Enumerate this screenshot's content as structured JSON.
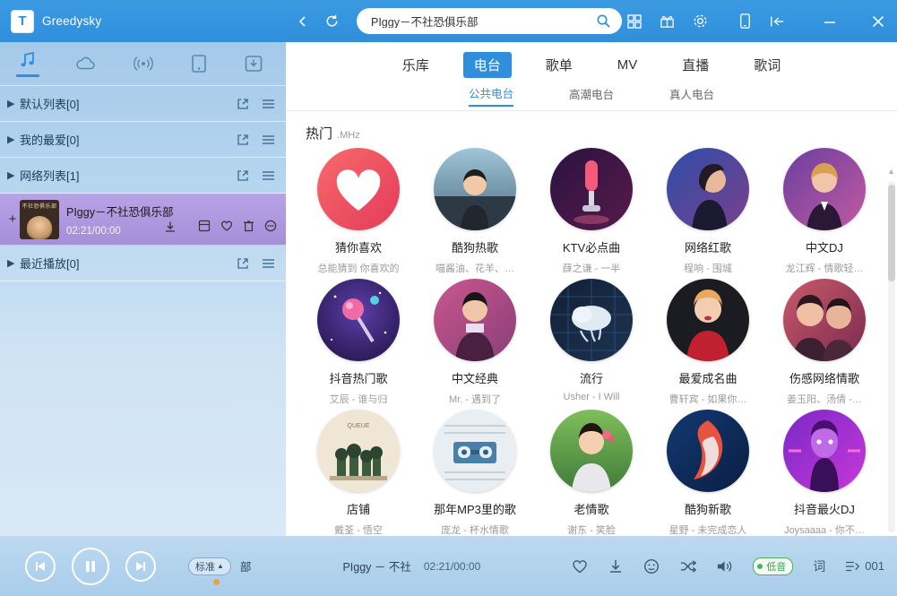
{
  "titlebar": {
    "app_name": "Greedysky",
    "logo_letter": "T",
    "search_value": "PIggy－不社恐俱乐部",
    "icons": {
      "back": "back-arrow-icon",
      "refresh": "refresh-icon",
      "search": "search-icon",
      "radar": "radar-icon",
      "grid": "grid-icon",
      "gift": "gift-icon",
      "settings": "gear-icon",
      "mobile": "mobile-icon",
      "collapse": "collapse-icon",
      "minimize": "minimize-icon",
      "close": "close-icon"
    }
  },
  "sidebar": {
    "tabs": [
      {
        "name": "music",
        "icon": "music-note-icon",
        "active": true
      },
      {
        "name": "cloud",
        "icon": "cloud-icon",
        "active": false
      },
      {
        "name": "radio",
        "icon": "broadcast-icon",
        "active": false
      },
      {
        "name": "device",
        "icon": "device-icon",
        "active": false
      },
      {
        "name": "download",
        "icon": "download-icon",
        "active": false
      }
    ],
    "lists": [
      {
        "label": "默认列表[0]",
        "expanded": false
      },
      {
        "label": "我的最爱[0]",
        "expanded": false
      },
      {
        "label": "网络列表[1]",
        "expanded": true
      },
      {
        "label": "最近播放[0]",
        "expanded": false
      }
    ],
    "track": {
      "title": "PIggy－不社恐俱乐部",
      "time": "02:21/00:00",
      "art_label": "不社恐俱乐部",
      "icons": [
        "download-icon",
        "playlist-icon",
        "heart-icon",
        "trash-icon",
        "more-icon"
      ]
    }
  },
  "main": {
    "tabs": [
      {
        "label": "乐库",
        "active": false
      },
      {
        "label": "电台",
        "active": true
      },
      {
        "label": "歌单",
        "active": false
      },
      {
        "label": "MV",
        "active": false
      },
      {
        "label": "直播",
        "active": false
      },
      {
        "label": "歌词",
        "active": false
      }
    ],
    "sub_tabs": [
      {
        "label": "公共电台",
        "active": true
      },
      {
        "label": "高潮电台",
        "active": false
      },
      {
        "label": "真人电台",
        "active": false
      }
    ],
    "section_title": "热门",
    "section_subtitle": ".MHz",
    "stations": [
      {
        "name": "猜你喜欢",
        "sub": "总能猜到 你喜欢的",
        "art": "heart-red"
      },
      {
        "name": "酷狗热歌",
        "sub": "喵酱油、花羊、…",
        "art": "girl-wall"
      },
      {
        "name": "KTV必点曲",
        "sub": "薛之谦 - 一半",
        "art": "mic-pink"
      },
      {
        "name": "网络红歌",
        "sub": "程响 - 围城",
        "art": "girl-blue"
      },
      {
        "name": "中文DJ",
        "sub": "龙江辉 - 情歌轻…",
        "art": "girl-purple"
      },
      {
        "name": "抖音热门歌",
        "sub": "艾辰 - 谁与归",
        "art": "space-pink"
      },
      {
        "name": "中文经典",
        "sub": "Mr. - 遇到了",
        "art": "man-pink"
      },
      {
        "name": "流行",
        "sub": "Usher - I Will",
        "art": "cloud-dark"
      },
      {
        "name": "最爱成名曲",
        "sub": "曹轩宾 - 如果你…",
        "art": "woman-red"
      },
      {
        "name": "伤感网络情歌",
        "sub": "姜玉阳、汤倩 -…",
        "art": "couple"
      },
      {
        "name": "店铺",
        "sub": "戴荃 - 悟空",
        "art": "shop-cream"
      },
      {
        "name": "那年MP3里的歌",
        "sub": "庞龙 - 杯水情歌",
        "art": "tape-blue"
      },
      {
        "name": "老情歌",
        "sub": "谢东 - 笑脸",
        "art": "woman-green"
      },
      {
        "name": "酷狗新歌",
        "sub": "星野 - 未完成恋人",
        "art": "blue-abstract"
      },
      {
        "name": "抖音最火DJ",
        "sub": "Joysaaaa - 你不…",
        "art": "neon-head"
      }
    ]
  },
  "player": {
    "controls": {
      "prev": "previous-icon",
      "play": "pause-icon",
      "next": "next-icon"
    },
    "quality_label": "标准",
    "mode_label": "部",
    "now_playing": "PIggy －  不社",
    "now_time": "02:21/00:00",
    "icons": [
      "heart-icon",
      "download-icon",
      "emoji-icon",
      "shuffle-icon",
      "volume-icon"
    ],
    "low_quality_label": "低音",
    "lyrics_label": "词",
    "count": "001"
  },
  "colors": {
    "accent": "#2f8fdc",
    "titlebar": "#3b9ae1",
    "selected_row": "#a48fd8",
    "green": "#4bb35a"
  }
}
